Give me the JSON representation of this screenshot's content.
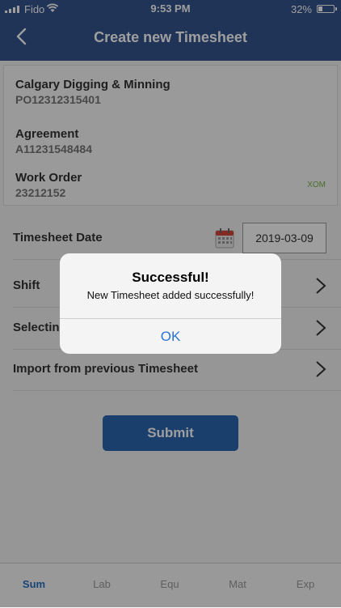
{
  "status": {
    "carrier": "Fido",
    "time": "9:53 PM",
    "battery": "32%",
    "battery_level": 0.32
  },
  "header": {
    "title": "Create new Timesheet"
  },
  "card": {
    "company": {
      "label": "Calgary Digging & Minning",
      "value": "PO12312315401"
    },
    "agreement": {
      "label": "Agreement",
      "value": "A11231548484"
    },
    "work_order": {
      "label": "Work Order",
      "value": "23212152"
    },
    "tag": "XOM"
  },
  "rows": {
    "timesheet_date": {
      "label": "Timesheet Date",
      "value": "2019-03-09"
    },
    "shift": {
      "label": "Shift"
    },
    "selecting": {
      "label": "Selecting"
    },
    "import": {
      "label": "Import from previous Timesheet"
    }
  },
  "submit_label": "Submit",
  "tabs": [
    {
      "label": "Sum",
      "active": true
    },
    {
      "label": "Lab"
    },
    {
      "label": "Equ"
    },
    {
      "label": "Mat"
    },
    {
      "label": "Exp"
    }
  ],
  "alert": {
    "title": "Successful!",
    "message": "New Timesheet added successfully!",
    "ok_label": "OK"
  },
  "colors": {
    "header": "#34548f",
    "accent": "#2a6fbe",
    "submit": "#2a67b0",
    "tag": "#7ab04a"
  }
}
